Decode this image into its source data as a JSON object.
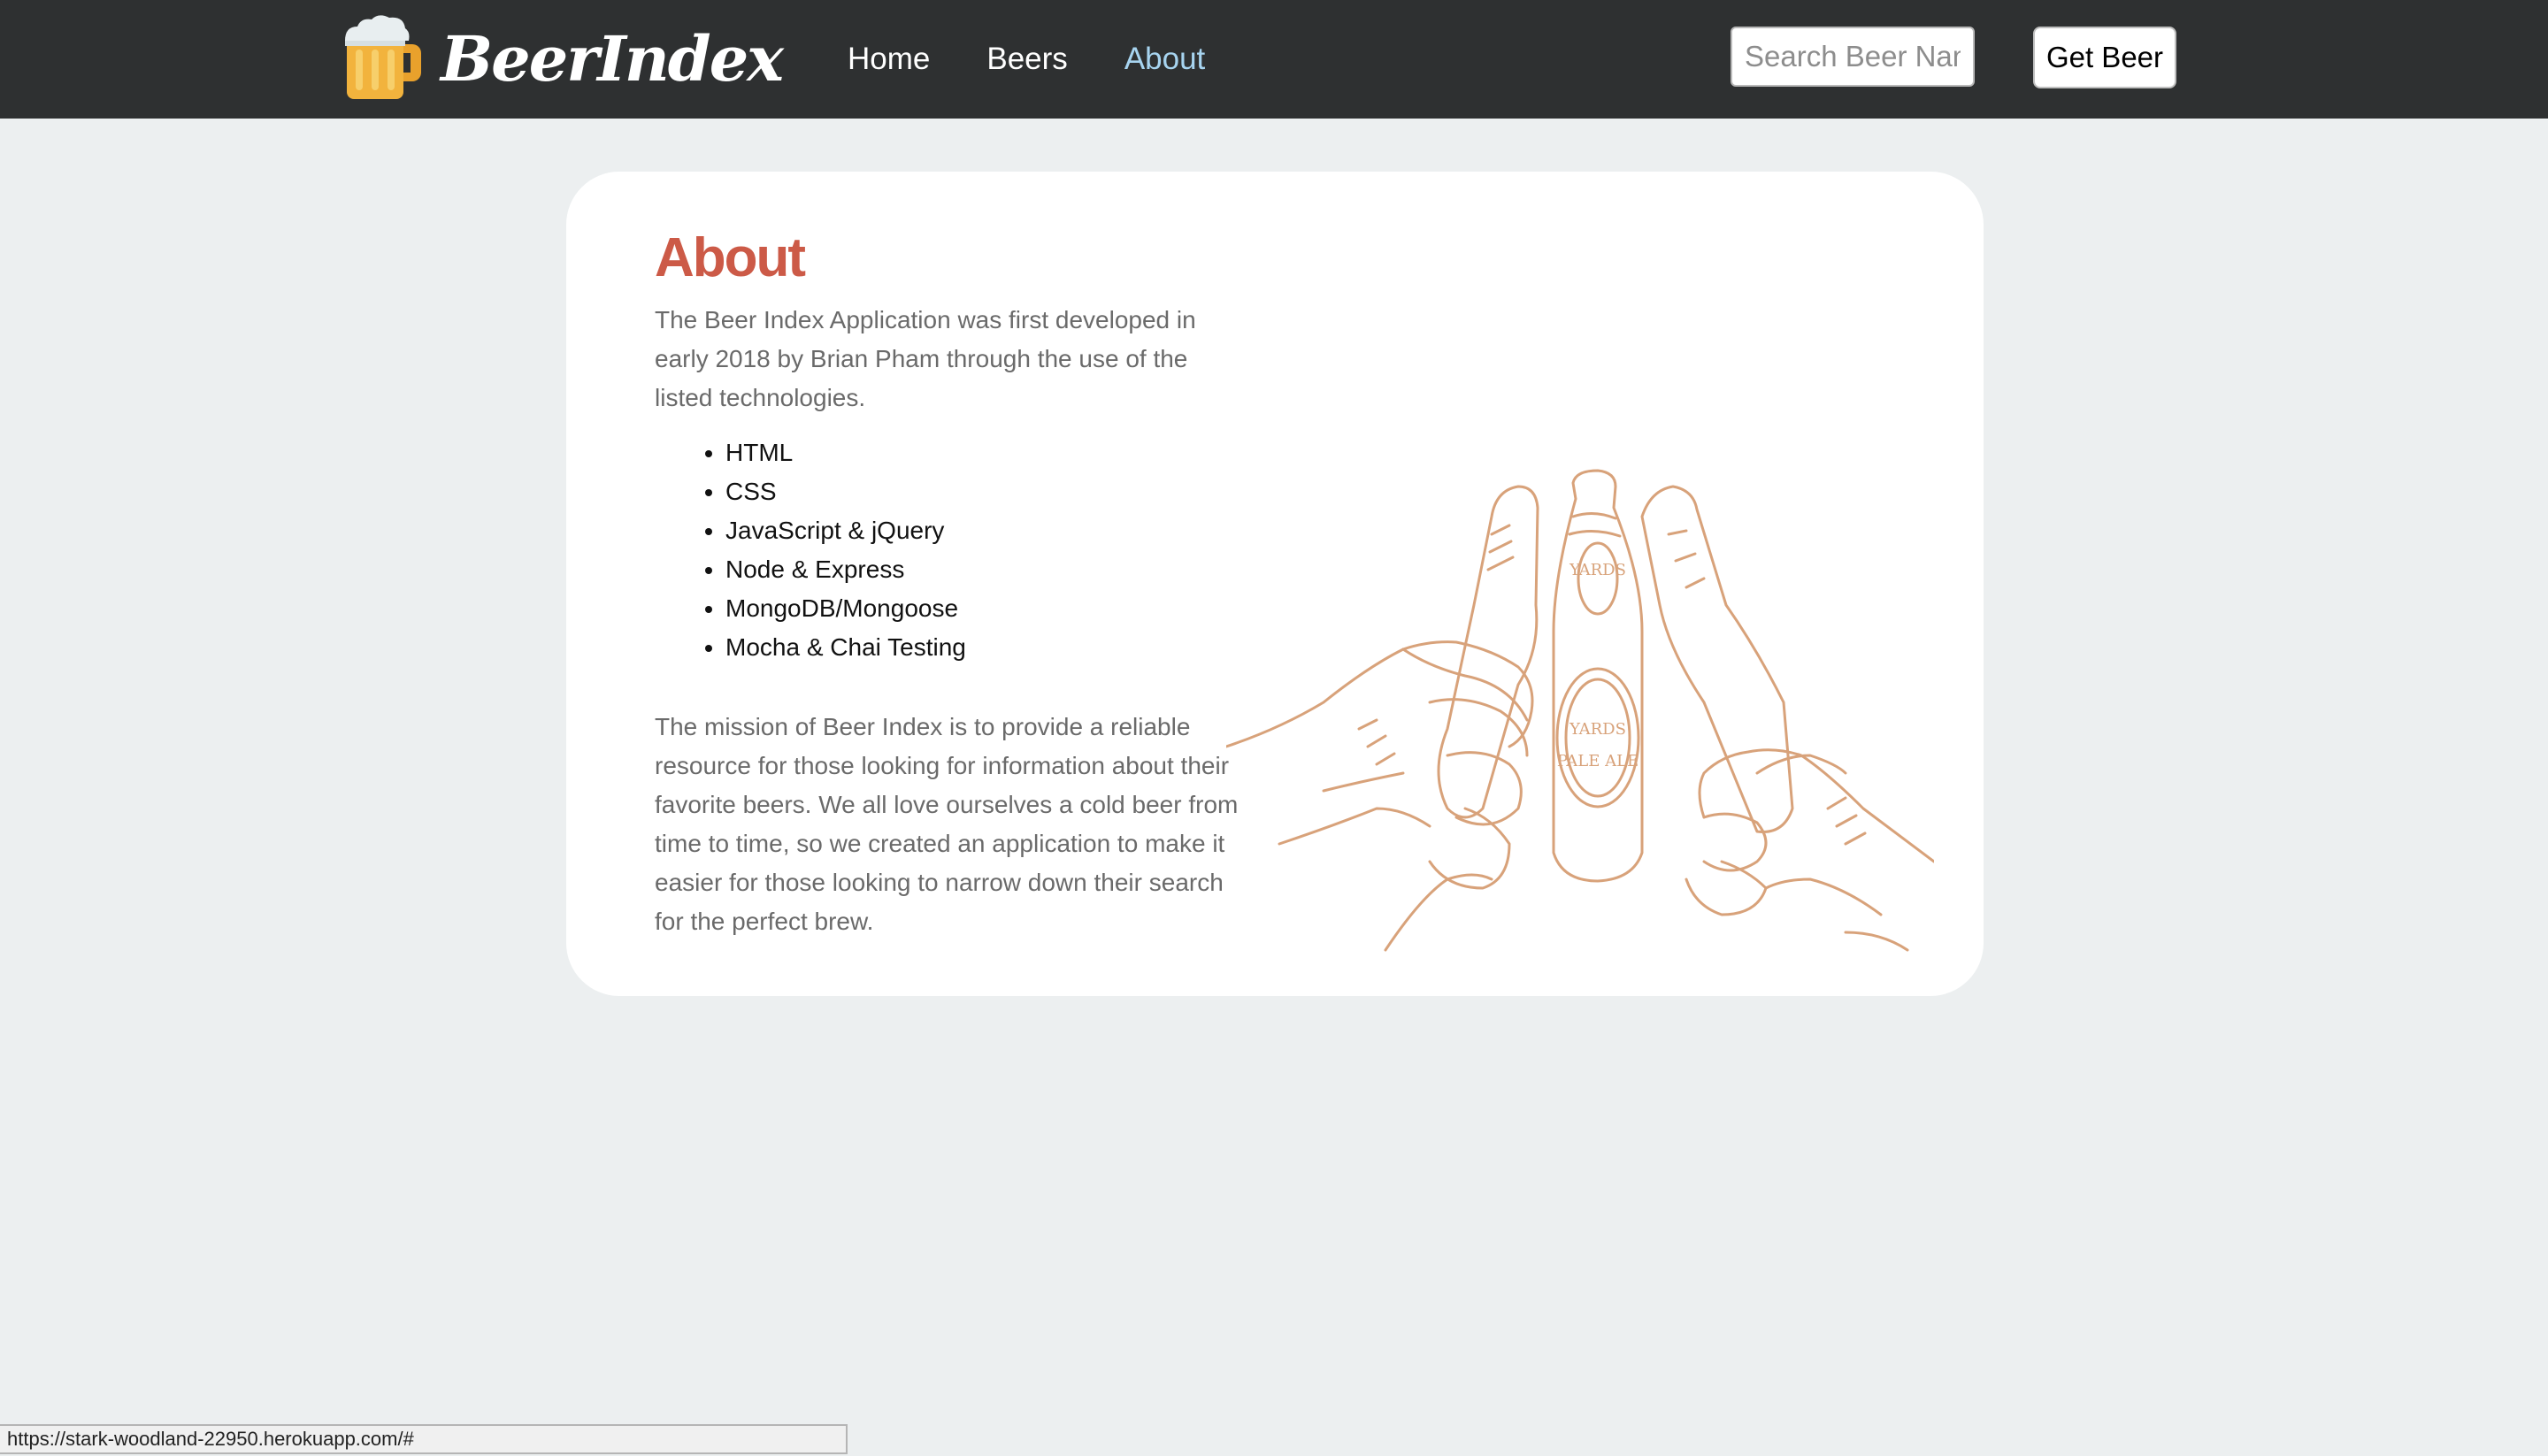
{
  "header": {
    "brand": "BeerIndex",
    "nav": [
      {
        "label": "Home",
        "active": false
      },
      {
        "label": "Beers",
        "active": false
      },
      {
        "label": "About",
        "active": true
      }
    ],
    "search": {
      "placeholder": "Search Beer Name...",
      "value": "",
      "button_label": "Get Beer"
    }
  },
  "about": {
    "title": "About",
    "intro": "The Beer Index Application was first developed in early 2018 by Brian Pham through the use of the listed technologies.",
    "technologies": [
      "HTML",
      "CSS",
      "JavaScript & jQuery",
      "Node & Express",
      "MongoDB/Mongoose",
      "Mocha & Chai Testing"
    ],
    "mission": "The mission of Beer Index is to provide a reliable resource for those looking for information about their favorite beers. We all love ourselves a cold beer from time to time, so we created an application to make it easier for those looking to narrow down their search for the perfect brew.",
    "illustration": {
      "icon": "beer-toast-illustration",
      "bottle_label_top": "YARDS",
      "bottle_label_main": "PALE ALE"
    }
  },
  "status_bar": {
    "url": "https://stark-woodland-22950.herokuapp.com/#"
  },
  "colors": {
    "navbar_bg": "#2e3031",
    "page_bg": "#eceff0",
    "title_accent": "#cc5a47",
    "nav_active": "#a7d4f0",
    "sketch": "#d8a27a",
    "mug_gold": "#f2b33d"
  }
}
